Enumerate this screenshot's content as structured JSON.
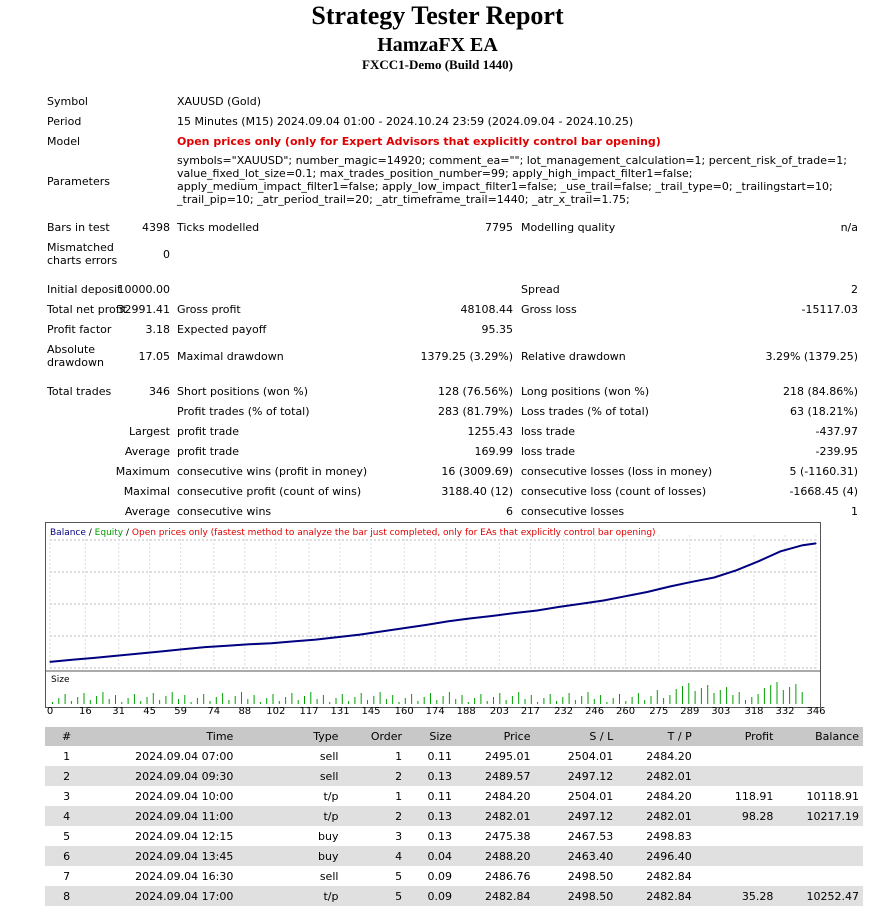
{
  "header": {
    "title": "Strategy Tester Report",
    "ea": "HamzaFX EA",
    "server": "FXCC1-Demo (Build 1440)"
  },
  "settings": {
    "symbol_label": "Symbol",
    "symbol": "XAUUSD (Gold)",
    "period_label": "Period",
    "period": "15 Minutes (M15) 2024.09.04 01:00 - 2024.10.24 23:59 (2024.09.04 - 2024.10.25)",
    "model_label": "Model",
    "model": "Open prices only (only for Expert Advisors that explicitly control bar opening)",
    "parameters_label": "Parameters",
    "parameters": "symbols=\"XAUUSD\"; number_magic=14920; comment_ea=\"\"; lot_management_calculation=1; percent_risk_of_trade=1; value_fixed_lot_size=0.1; max_trades_position_number=99; apply_high_impact_filter1=false; apply_medium_impact_filter1=false; apply_low_impact_filter1=false; _use_trail=false; _trail_type=0; _trailingstart=10; _trail_pip=10; _atr_period_trail=20; _atr_timeframe_trail=1440; _atr_x_trail=1.75;"
  },
  "stats": {
    "bars_label": "Bars in test",
    "bars": "4398",
    "ticks_label": "Ticks modelled",
    "ticks": "7795",
    "quality_label": "Modelling quality",
    "quality": "n/a",
    "mismatch_label_1": "Mismatched",
    "mismatch_label_2": "charts errors",
    "mismatch": "0",
    "deposit_label": "Initial deposit",
    "deposit": "10000.00",
    "spread_label": "Spread",
    "spread": "2",
    "net_label": "Total net profit",
    "net": "32991.41",
    "gross_profit_label": "Gross profit",
    "gross_profit": "48108.44",
    "gross_loss_label": "Gross loss",
    "gross_loss": "-15117.03",
    "pf_label": "Profit factor",
    "pf": "3.18",
    "payoff_label": "Expected payoff",
    "payoff": "95.35",
    "abs_dd_label_1": "Absolute",
    "abs_dd_label_2": "drawdown",
    "abs_dd": "17.05",
    "max_dd_label": "Maximal drawdown",
    "max_dd": "1379.25 (3.29%)",
    "rel_dd_label": "Relative drawdown",
    "rel_dd": "3.29% (1379.25)",
    "trades_label": "Total trades",
    "trades": "346",
    "short_label": "Short positions (won %)",
    "short": "128 (76.56%)",
    "long_label": "Long positions (won %)",
    "long": "218 (84.86%)",
    "profit_trades_label": "Profit trades (% of total)",
    "profit_trades": "283 (81.79%)",
    "loss_trades_label": "Loss trades (% of total)",
    "loss_trades": "63 (18.21%)",
    "largest_label": "Largest",
    "largest_profit_label": "profit trade",
    "largest_profit": "1255.43",
    "largest_loss_label": "loss trade",
    "largest_loss": "-437.97",
    "average_label": "Average",
    "avg_profit_label": "profit trade",
    "avg_profit": "169.99",
    "avg_loss_label": "loss trade",
    "avg_loss": "-239.95",
    "maximum_label": "Maximum",
    "max_wins_label": "consecutive wins (profit in money)",
    "max_wins": "16 (3009.69)",
    "max_losses_label": "consecutive losses (loss in money)",
    "max_losses": "5 (-1160.31)",
    "maximal_label": "Maximal",
    "cons_profit_label": "consecutive profit (count of wins)",
    "cons_profit": "3188.40 (12)",
    "cons_loss_label": "consecutive loss (count of losses)",
    "cons_loss": "-1668.45 (4)",
    "avg2_label": "Average",
    "avg_cons_wins_label": "consecutive wins",
    "avg_cons_wins": "6",
    "avg_cons_losses_label": "consecutive losses",
    "avg_cons_losses": "1"
  },
  "chart_data": {
    "type": "line",
    "legend": {
      "balance": "Balance",
      "sep1": " / ",
      "equity": "Equity",
      "sep2": " / ",
      "note": "Open prices only (fastest method to analyze the bar just completed, only for EAs that explicitly control bar opening)"
    },
    "colors": {
      "balance": "#000080",
      "equity": "#00a000",
      "note": "#e00000",
      "size": "#00a000"
    },
    "y_ticks": [
      43946,
      35032,
      26119,
      17206,
      8292
    ],
    "x_ticks": [
      0,
      16,
      31,
      45,
      59,
      74,
      88,
      102,
      117,
      131,
      145,
      160,
      174,
      188,
      203,
      217,
      232,
      246,
      260,
      275,
      289,
      303,
      318,
      332,
      346
    ],
    "size_label": "Size",
    "series": [
      {
        "name": "Balance",
        "x": [
          0,
          10,
          20,
          30,
          40,
          50,
          60,
          70,
          80,
          90,
          100,
          110,
          120,
          130,
          140,
          150,
          160,
          170,
          180,
          190,
          200,
          210,
          220,
          230,
          240,
          250,
          260,
          270,
          280,
          290,
          300,
          310,
          320,
          330,
          340,
          346
        ],
        "values": [
          10000,
          10600,
          11100,
          11700,
          12300,
          12900,
          13500,
          14100,
          14500,
          14900,
          15200,
          15700,
          16200,
          16900,
          17600,
          18500,
          19400,
          20300,
          21300,
          22100,
          22800,
          23600,
          24300,
          25300,
          26200,
          27100,
          28300,
          29500,
          31000,
          32300,
          33500,
          35500,
          38000,
          40800,
          42500,
          42991
        ]
      }
    ]
  },
  "deals": {
    "headers": [
      "#",
      "Time",
      "Type",
      "Order",
      "Size",
      "Price",
      "S / L",
      "T / P",
      "Profit",
      "Balance"
    ],
    "rows": [
      [
        "1",
        "2024.09.04 07:00",
        "sell",
        "1",
        "0.11",
        "2495.01",
        "2504.01",
        "2484.20",
        "",
        ""
      ],
      [
        "2",
        "2024.09.04 09:30",
        "sell",
        "2",
        "0.13",
        "2489.57",
        "2497.12",
        "2482.01",
        "",
        ""
      ],
      [
        "3",
        "2024.09.04 10:00",
        "t/p",
        "1",
        "0.11",
        "2484.20",
        "2504.01",
        "2484.20",
        "118.91",
        "10118.91"
      ],
      [
        "4",
        "2024.09.04 11:00",
        "t/p",
        "2",
        "0.13",
        "2482.01",
        "2497.12",
        "2482.01",
        "98.28",
        "10217.19"
      ],
      [
        "5",
        "2024.09.04 12:15",
        "buy",
        "3",
        "0.13",
        "2475.38",
        "2467.53",
        "2498.83",
        "",
        ""
      ],
      [
        "6",
        "2024.09.04 13:45",
        "buy",
        "4",
        "0.04",
        "2488.20",
        "2463.40",
        "2496.40",
        "",
        ""
      ],
      [
        "7",
        "2024.09.04 16:30",
        "sell",
        "5",
        "0.09",
        "2486.76",
        "2498.50",
        "2482.84",
        "",
        ""
      ],
      [
        "8",
        "2024.09.04 17:00",
        "t/p",
        "5",
        "0.09",
        "2482.84",
        "2498.50",
        "2482.84",
        "35.28",
        "10252.47"
      ]
    ]
  }
}
